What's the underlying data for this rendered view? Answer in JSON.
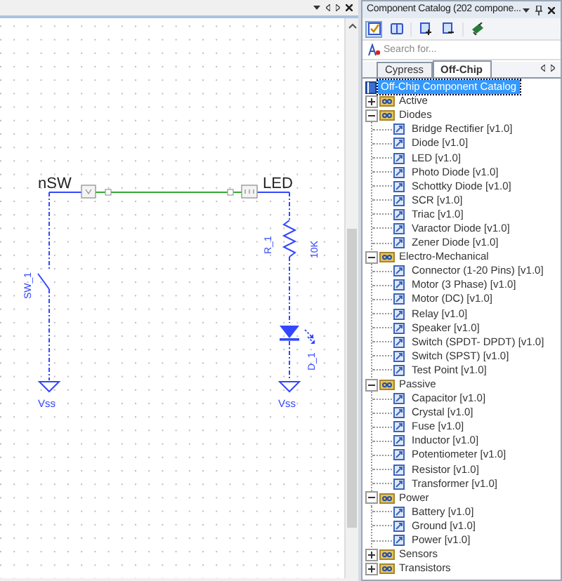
{
  "schematic": {
    "labels": [
      {
        "kind": "net",
        "text": "nSW"
      },
      {
        "kind": "net",
        "text": "LED"
      },
      {
        "kind": "ref",
        "text": "SW_1"
      },
      {
        "kind": "ref",
        "text": "R_1"
      },
      {
        "kind": "value",
        "text": "10K"
      },
      {
        "kind": "ref",
        "text": "D_1"
      },
      {
        "kind": "power",
        "text": "Vss"
      },
      {
        "kind": "power",
        "text": "Vss"
      }
    ]
  },
  "catalog": {
    "title": "Component Catalog (202 compone...",
    "search": {
      "placeholder": "Search for..."
    },
    "tabs": [
      {
        "label": "Cypress",
        "selected": false
      },
      {
        "label": "Off-Chip",
        "selected": true
      }
    ],
    "tree": [
      {
        "label": "Off-Chip Component Catalog",
        "kind": "root",
        "selected": true,
        "children": [
          {
            "label": "Active",
            "kind": "folder",
            "expanded": false,
            "selected": false
          },
          {
            "label": "Diodes",
            "kind": "folder",
            "expanded": true,
            "selected": false,
            "children": [
              {
                "label": "Bridge Rectifier [v1.0]",
                "kind": "component",
                "selected": false
              },
              {
                "label": "Diode [v1.0]",
                "kind": "component",
                "selected": false
              },
              {
                "label": "LED [v1.0]",
                "kind": "component",
                "selected": false
              },
              {
                "label": "Photo Diode [v1.0]",
                "kind": "component",
                "selected": false
              },
              {
                "label": "Schottky Diode [v1.0]",
                "kind": "component",
                "selected": false
              },
              {
                "label": "SCR [v1.0]",
                "kind": "component",
                "selected": false
              },
              {
                "label": "Triac [v1.0]",
                "kind": "component",
                "selected": false
              },
              {
                "label": "Varactor Diode [v1.0]",
                "kind": "component",
                "selected": false
              },
              {
                "label": "Zener Diode [v1.0]",
                "kind": "component",
                "selected": false
              }
            ]
          },
          {
            "label": "Electro-Mechanical",
            "kind": "folder",
            "expanded": true,
            "selected": false,
            "children": [
              {
                "label": "Connector (1-20 Pins) [v1.0]",
                "kind": "component",
                "selected": false
              },
              {
                "label": "Motor (3 Phase) [v1.0]",
                "kind": "component",
                "selected": false
              },
              {
                "label": "Motor (DC) [v1.0]",
                "kind": "component",
                "selected": false
              },
              {
                "label": "Relay [v1.0]",
                "kind": "component",
                "selected": false
              },
              {
                "label": "Speaker [v1.0]",
                "kind": "component",
                "selected": false
              },
              {
                "label": "Switch (SPDT- DPDT) [v1.0]",
                "kind": "component",
                "selected": false
              },
              {
                "label": "Switch (SPST) [v1.0]",
                "kind": "component",
                "selected": false
              },
              {
                "label": "Test Point [v1.0]",
                "kind": "component",
                "selected": false
              }
            ]
          },
          {
            "label": "Passive",
            "kind": "folder",
            "expanded": true,
            "selected": false,
            "children": [
              {
                "label": "Capacitor [v1.0]",
                "kind": "component",
                "selected": false
              },
              {
                "label": "Crystal [v1.0]",
                "kind": "component",
                "selected": false
              },
              {
                "label": "Fuse [v1.0]",
                "kind": "component",
                "selected": false
              },
              {
                "label": "Inductor [v1.0]",
                "kind": "component",
                "selected": false
              },
              {
                "label": "Potentiometer [v1.0]",
                "kind": "component",
                "selected": false
              },
              {
                "label": "Resistor [v1.0]",
                "kind": "component",
                "selected": false
              },
              {
                "label": "Transformer [v1.0]",
                "kind": "component",
                "selected": false
              }
            ]
          },
          {
            "label": "Power",
            "kind": "folder",
            "expanded": true,
            "selected": false,
            "children": [
              {
                "label": "Battery [v1.0]",
                "kind": "component",
                "selected": false
              },
              {
                "label": "Ground [v1.0]",
                "kind": "component",
                "selected": false
              },
              {
                "label": "Power [v1.0]",
                "kind": "component",
                "selected": false
              }
            ]
          },
          {
            "label": "Sensors",
            "kind": "folder",
            "expanded": false,
            "selected": false
          },
          {
            "label": "Transistors",
            "kind": "folder",
            "expanded": false,
            "selected": false
          }
        ]
      }
    ]
  }
}
